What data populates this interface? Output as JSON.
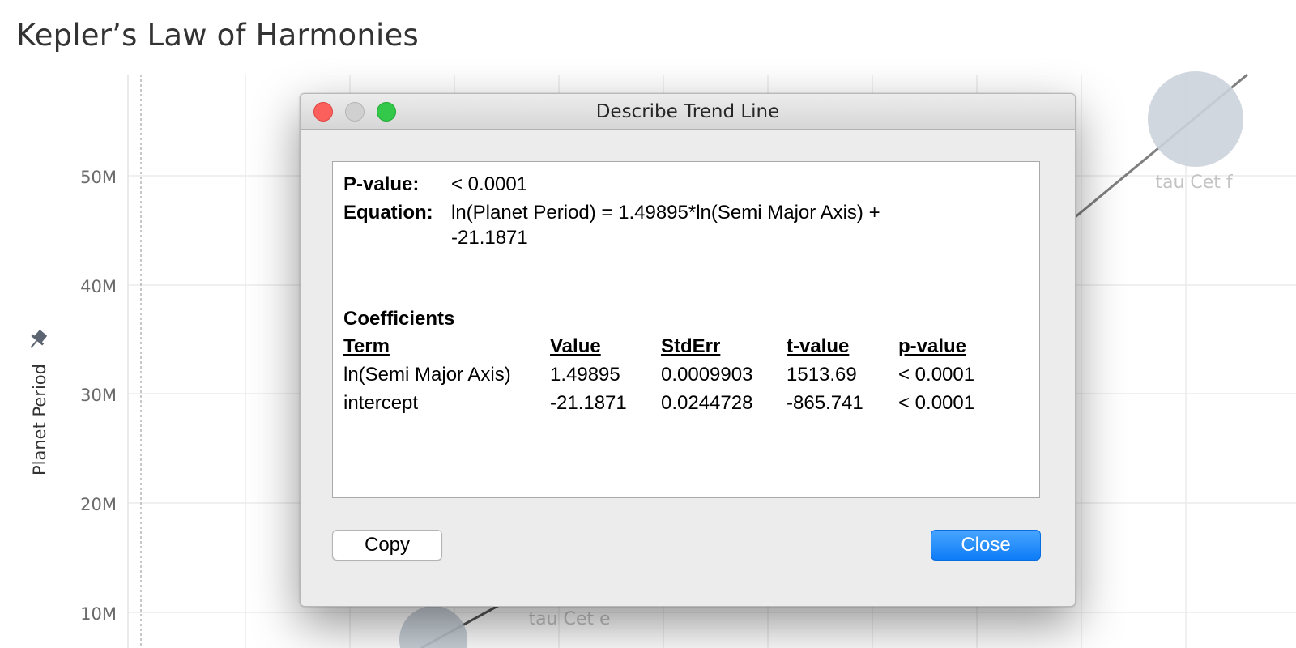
{
  "page": {
    "title": "Kepler’s Law of Harmonies"
  },
  "chart_data": {
    "type": "scatter",
    "title": "Kepler’s Law of Harmonies",
    "ylabel": "Planet Period",
    "yticks": [
      "10M",
      "20M",
      "30M",
      "40M",
      "50M"
    ],
    "yvalues": [
      10000000,
      20000000,
      30000000,
      40000000,
      50000000
    ],
    "points": [
      {
        "label": "tau Cet f"
      },
      {
        "label": "tau Cet e"
      }
    ],
    "trend_line": true,
    "pinned_axis": true
  },
  "dialog": {
    "title": "Describe Trend Line",
    "pvalue_label": "P-value:",
    "pvalue": "< 0.0001",
    "equation_label": "Equation:",
    "equation_line1": "ln(Planet Period) = 1.49895*ln(Semi Major Axis) +",
    "equation_line2": "-21.1871",
    "coefficients_title": "Coefficients",
    "columns": [
      "Term",
      "Value",
      "StdErr",
      "t-value",
      "p-value"
    ],
    "rows": [
      [
        "ln(Semi Major Axis)",
        "1.49895",
        "0.0009903",
        "1513.69",
        "< 0.0001"
      ],
      [
        "intercept",
        "-21.1871",
        "0.0244728",
        "-865.741",
        "< 0.0001"
      ]
    ],
    "copy_label": "Copy",
    "close_label": "Close"
  },
  "icons": {
    "pin": "pin-icon"
  },
  "colors": {
    "accent": "#1a84f8",
    "close_dot": "#fc605c",
    "min_dot": "#d0d0d0",
    "max_dot": "#34c84a"
  }
}
